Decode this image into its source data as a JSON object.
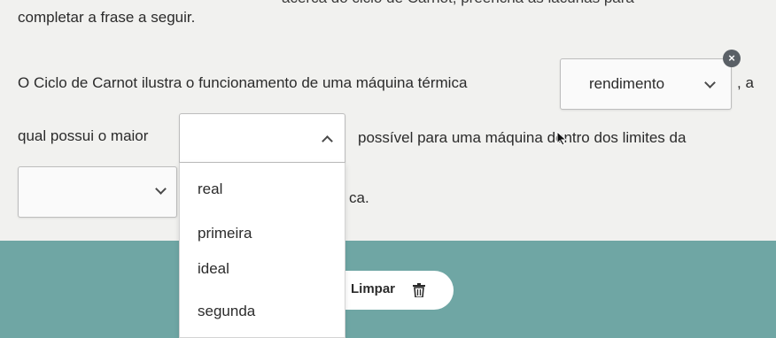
{
  "question": {
    "top_fragment_left": "acerca do ciclo de Carnot, preencha as lacunas para",
    "instruction": "completar a frase a seguir.",
    "line1_text": "O Ciclo de Carnot ilustra o funcionamento de uma máquina térmica",
    "line1_after": ", a",
    "line2_before": "qual possui o maior",
    "line2_after": "possível para uma máquina dentro dos limites da",
    "line3_after": "ca."
  },
  "blanks": [
    {
      "id": "blank-1",
      "value": "rendimento",
      "state": "selected"
    },
    {
      "id": "blank-2",
      "value": "",
      "state": "open"
    },
    {
      "id": "blank-3",
      "value": "",
      "state": "empty"
    }
  ],
  "dropdown_options": [
    "real",
    "primeira",
    "ideal",
    "segunda"
  ],
  "remove_badge": "×",
  "clear_button": {
    "label": "Limpar",
    "icon": "trash-icon"
  },
  "colors": {
    "footer": "#6fa6a4",
    "badge": "#5a6066"
  }
}
